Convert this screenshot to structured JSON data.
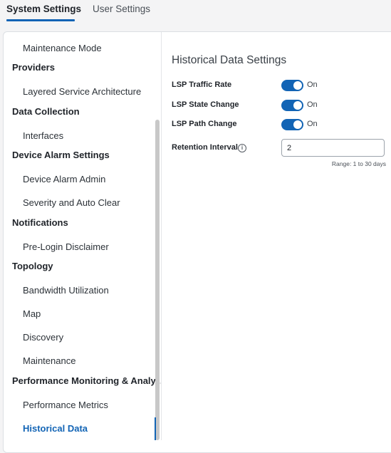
{
  "tabs": [
    {
      "label": "System Settings",
      "active": true
    },
    {
      "label": "User Settings",
      "active": false
    }
  ],
  "sidebar": {
    "items": [
      {
        "label": "Maintenance Mode",
        "level": "sub"
      },
      {
        "label": "Providers",
        "level": "group"
      },
      {
        "label": "Layered Service Architecture",
        "level": "sub"
      },
      {
        "label": "Data Collection",
        "level": "group"
      },
      {
        "label": "Interfaces",
        "level": "sub"
      },
      {
        "label": "Device Alarm Settings",
        "level": "group"
      },
      {
        "label": "Device Alarm Admin",
        "level": "sub"
      },
      {
        "label": "Severity and Auto Clear",
        "level": "sub"
      },
      {
        "label": "Notifications",
        "level": "group"
      },
      {
        "label": "Pre-Login Disclaimer",
        "level": "sub"
      },
      {
        "label": "Topology",
        "level": "group"
      },
      {
        "label": "Bandwidth Utilization",
        "level": "sub"
      },
      {
        "label": "Map",
        "level": "sub"
      },
      {
        "label": "Discovery",
        "level": "sub"
      },
      {
        "label": "Maintenance",
        "level": "sub"
      },
      {
        "label": "Performance Monitoring & Analy...",
        "level": "group"
      },
      {
        "label": "Performance Metrics",
        "level": "sub"
      },
      {
        "label": "Historical Data",
        "level": "sub",
        "active": true
      }
    ]
  },
  "content": {
    "title": "Historical Data Settings",
    "toggles": [
      {
        "label": "LSP Traffic Rate",
        "state": "On"
      },
      {
        "label": "LSP State Change",
        "state": "On"
      },
      {
        "label": "LSP Path Change",
        "state": "On"
      }
    ],
    "retention": {
      "label": "Retention Interval",
      "info_icon": "info-icon",
      "value": "2",
      "hint": "Range: 1 to 30 days"
    }
  },
  "colors": {
    "accent": "#1264b5",
    "panel_bg": "#ffffff",
    "page_bg": "#f4f4f5"
  }
}
